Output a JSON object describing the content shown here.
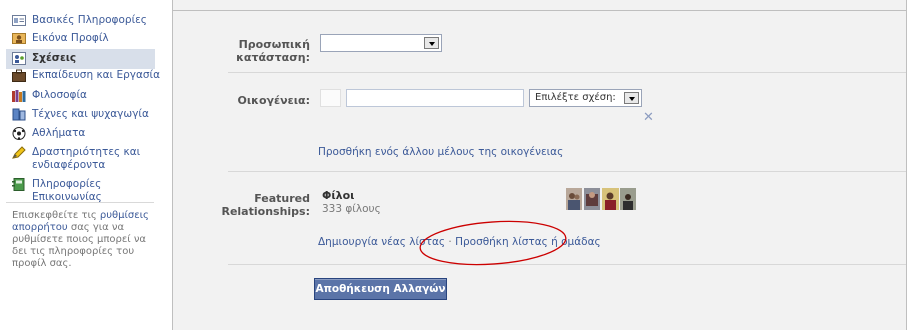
{
  "sidebar": {
    "items": [
      {
        "label": "Βασικές Πληροφορίες",
        "icon": "id-card-icon"
      },
      {
        "label": "Εικόνα Προφίλ",
        "icon": "profile-picture-icon"
      },
      {
        "label": "Σχέσεις",
        "icon": "relationships-icon",
        "active": true
      },
      {
        "label": "Εκπαίδευση και Εργασία",
        "icon": "briefcase-icon"
      },
      {
        "label": "Φιλοσοφία",
        "icon": "books-icon"
      },
      {
        "label": "Τέχνες και ψυχαγωγία",
        "icon": "film-icon"
      },
      {
        "label": "Αθλήματα",
        "icon": "soccer-ball-icon"
      },
      {
        "label_line1": "Δραστηριότητες και",
        "label_line2": "ενδιαφέροντα",
        "icon": "pencil-icon"
      },
      {
        "label": "Πληροφορίες Επικοινωνίας",
        "icon": "contact-book-icon"
      }
    ],
    "note_prefix": "Επισκεφθείτε τις ",
    "note_link": "ρυθμίσεις απορρήτου",
    "note_suffix": " σας για να ρυθμίσετε ποιος μπορεί να δει τις πληροφορίες του προφίλ σας."
  },
  "form": {
    "relationship_status_label_line1": "Προσωπική",
    "relationship_status_label_line2": "κατάσταση:",
    "relationship_status_value": "",
    "family_label": "Οικογένεια:",
    "family_name_value": "",
    "family_relation_select": "Επιλέξτε σχέση:",
    "add_family_member_link": "Προσθήκη ενός άλλου μέλους της οικογένειας",
    "featured_label_line1": "Featured",
    "featured_label_line2": "Relationships:",
    "featured_list_title": "Φίλοι",
    "featured_list_count": "333 φίλους",
    "create_list_link": "Δημιουργία νέας λίστας",
    "separator": " · ",
    "add_list_link": "Προσθήκη λίστας ή ομάδας",
    "save_button": "Αποθήκευση Αλλαγών"
  },
  "colors": {
    "link": "#3b5998",
    "save_button_bg": "#5b74a8",
    "panel_bg": "#f2f2f2",
    "annotation_ellipse": "#cc0000"
  }
}
